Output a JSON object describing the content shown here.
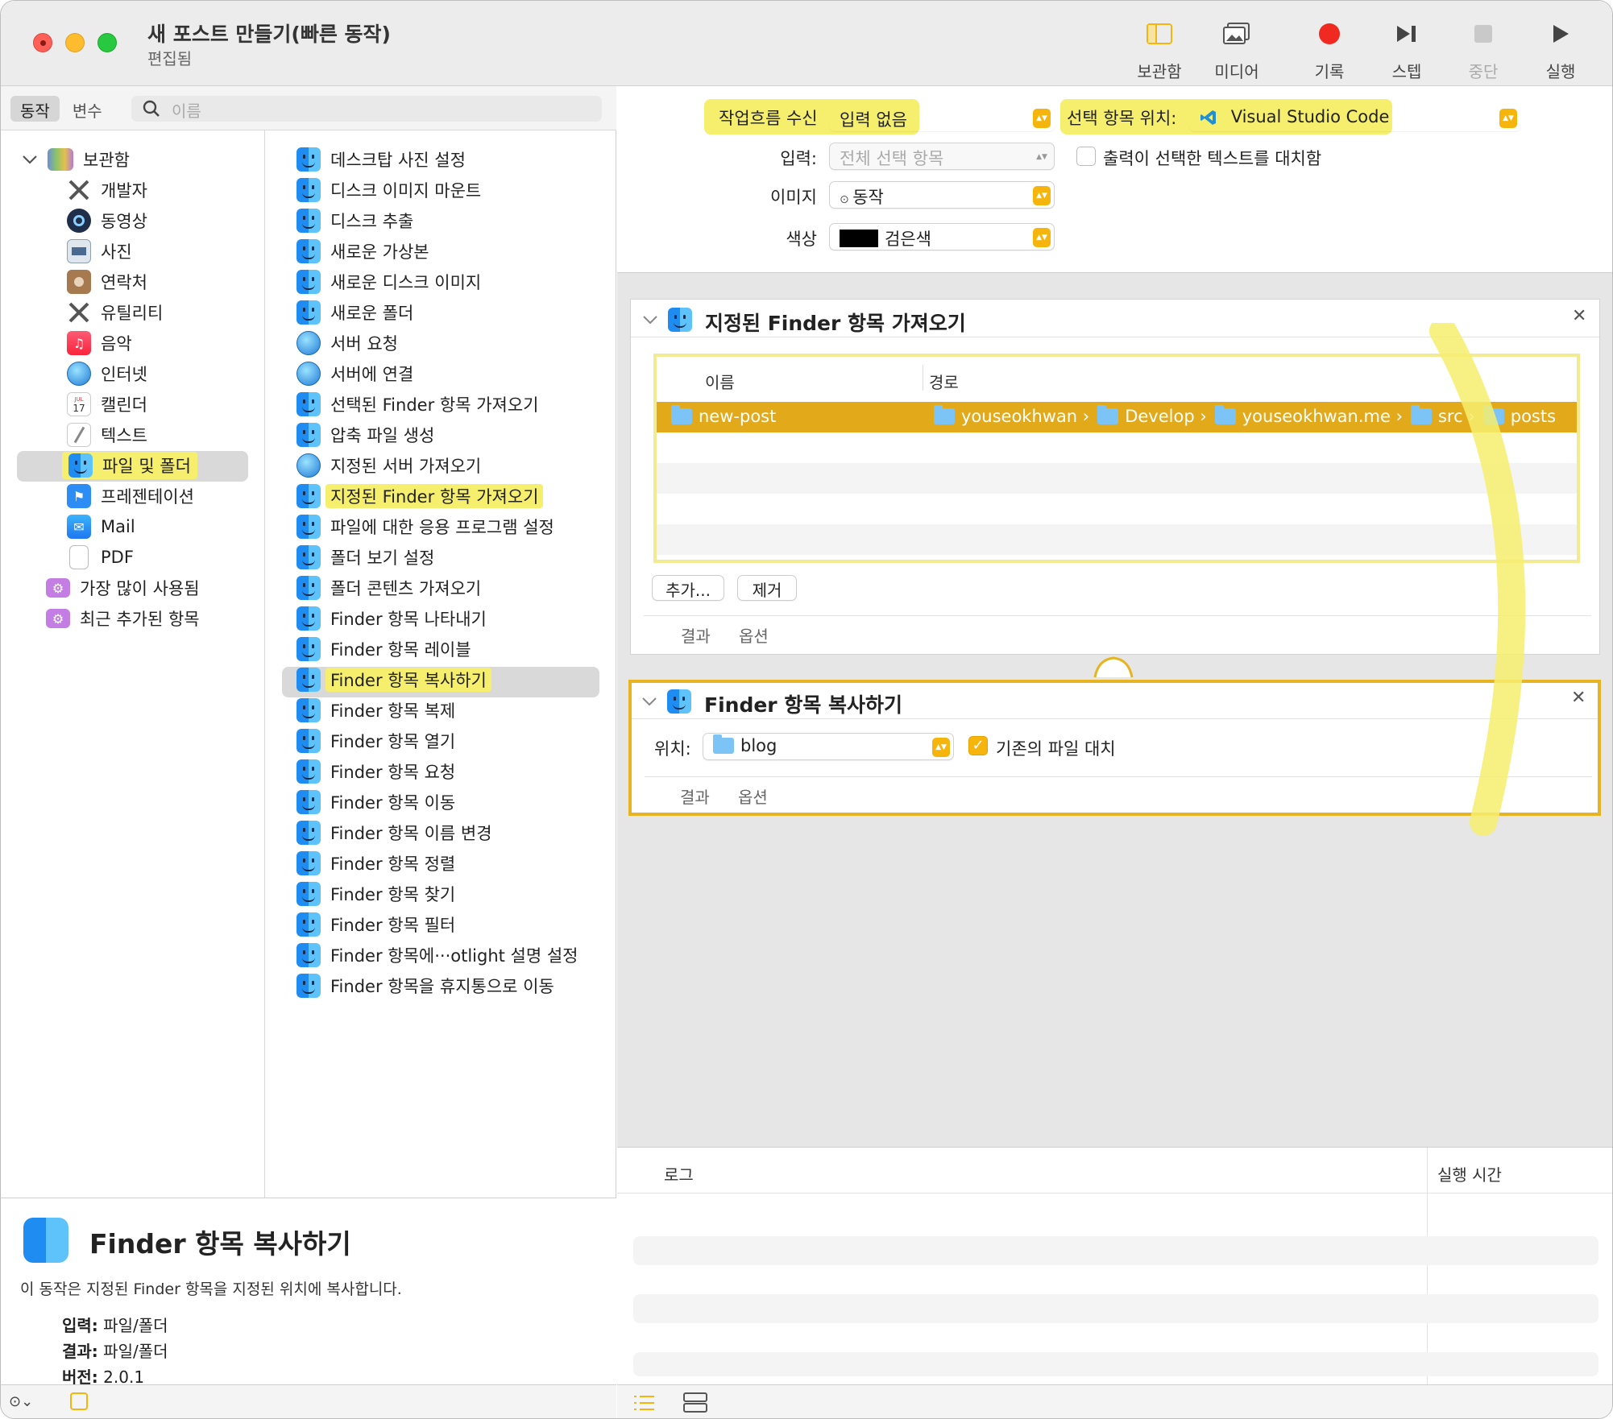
{
  "window": {
    "title": "새 포스트 만들기(빠른 동작)",
    "subtitle": "편집됨"
  },
  "toolbar": {
    "library": "보관함",
    "media": "미디어",
    "record": "기록",
    "step": "스텝",
    "stop": "중단",
    "run": "실행"
  },
  "left_tabs": {
    "actions": "동작",
    "variables": "변수"
  },
  "search": {
    "placeholder": "이름"
  },
  "library": {
    "root": "보관함",
    "items": [
      "개발자",
      "동영상",
      "사진",
      "연락처",
      "유틸리티",
      "음악",
      "인터넷",
      "캘린더",
      "텍스트",
      "파일 및 폴더",
      "프레젠테이션",
      "Mail",
      "PDF"
    ],
    "smart": [
      "가장 많이 사용됨",
      "최근 추가된 항목"
    ],
    "calendar_badge_month": "JUL",
    "calendar_badge_day": "17"
  },
  "actions": [
    "데스크탑 사진 설정",
    "디스크 이미지 마운트",
    "디스크 추출",
    "새로운 가상본",
    "새로운 디스크 이미지",
    "새로운 폴더",
    "서버 요청",
    "서버에 연결",
    "선택된 Finder 항목 가져오기",
    "압축 파일 생성",
    "지정된 서버 가져오기",
    "지정된 Finder 항목 가져오기",
    "파일에 대한 응용 프로그램 설정",
    "폴더 보기 설정",
    "폴더 콘텐츠 가져오기",
    "Finder 항목 나타내기",
    "Finder 항목 레이블",
    "Finder 항목 복사하기",
    "Finder 항목 복제",
    "Finder 항목 열기",
    "Finder 항목 요청",
    "Finder 항목 이동",
    "Finder 항목 이름 변경",
    "Finder 항목 정렬",
    "Finder 항목 찾기",
    "Finder 항목 필터",
    "Finder 항목에···otlight 설명 설정",
    "Finder 항목을 휴지통으로 이동"
  ],
  "description": {
    "title": "Finder 항목 복사하기",
    "text": "이 동작은 지정된 Finder 항목을 지정된 위치에 복사합니다.",
    "input_label": "입력:",
    "input_value": "파일/폴더",
    "result_label": "결과:",
    "result_value": "파일/폴더",
    "version_label": "버전:",
    "version_value": "2.0.1"
  },
  "workflow": {
    "receives_label": "작업흐름 수신",
    "receives_value": "입력 없음",
    "location_label": "선택 항목 위치:",
    "location_value": "Visual Studio Code",
    "input_label": "입력:",
    "input_value": "전체 선택 항목",
    "replace_label": "출력이 선택한 텍스트를 대치함",
    "image_label": "이미지",
    "image_value": "동작",
    "color_label": "색상",
    "color_value": "검은색"
  },
  "card1": {
    "title": "지정된 Finder 항목 가져오기",
    "col_name": "이름",
    "col_path": "경로",
    "row_name": "new-post",
    "path": [
      "youseokhwan",
      "Develop",
      "youseokhwan.me",
      "src",
      "posts"
    ],
    "add": "추가...",
    "remove": "제거",
    "tab_results": "결과",
    "tab_options": "옵션"
  },
  "card2": {
    "title": "Finder 항목 복사하기",
    "to_label": "위치:",
    "to_value": "blog",
    "replace_label": "기존의 파일 대치",
    "tab_results": "결과",
    "tab_options": "옵션"
  },
  "log": {
    "col_log": "로그",
    "col_time": "실행 시간"
  },
  "colors": {
    "accent": "#f6b50d",
    "highlight": "#f6ef6e",
    "selected_row": "#e2a91b"
  }
}
